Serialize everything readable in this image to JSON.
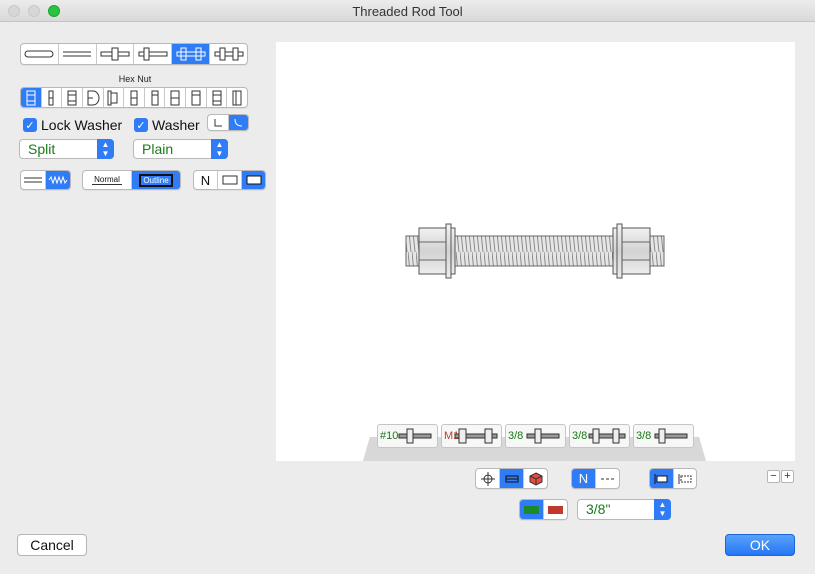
{
  "window": {
    "title": "Threaded Rod Tool"
  },
  "colors": {
    "accent": "#2f7cf6",
    "green_text": "#1a7a1a",
    "red_text": "#c0392b",
    "swatch_green": "#1a8a2a",
    "swatch_red": "#c0392b"
  },
  "rod_style_bar": {
    "selected_index": 4,
    "items": [
      "plain-rod-icon",
      "double-line-rod-icon",
      "rod-with-center-nut-icon",
      "rod-with-end-nut-icon",
      "rod-with-two-nuts-icon",
      "rod-with-two-nut-outline-icon"
    ]
  },
  "nut_type": {
    "label": "Hex Nut",
    "selected_index": 0,
    "items": [
      "hex-nut-icon",
      "thin-nut-icon",
      "jam-nut-icon",
      "cap-nut-icon",
      "flange-nut-icon",
      "wing-nut-icon",
      "coupling-nut-icon",
      "heavy-nut-icon",
      "slotted-nut-icon",
      "castle-nut-icon",
      "lock-nut-icon"
    ]
  },
  "options": {
    "lock_washer_label": "Lock Washer",
    "washer_label": "Washer"
  },
  "popups": {
    "lock_washer_type": "Split",
    "washer_type": "Plain",
    "size": "3/8\""
  },
  "line_style": {
    "normal_label": "Normal",
    "outline_label": "Outline",
    "selected": "outline"
  },
  "view_toggle": {
    "n_label": "N"
  },
  "display_toggle": {
    "n_label": "N"
  },
  "size_thumbnails": [
    {
      "label": "#10"
    },
    {
      "label": "M10"
    },
    {
      "label": "3/8"
    },
    {
      "label": "3/8"
    },
    {
      "label": "3/8"
    }
  ],
  "zoom": {
    "minus_label": "−",
    "plus_label": "+"
  },
  "buttons": {
    "cancel_label": "Cancel",
    "ok_label": "OK"
  }
}
